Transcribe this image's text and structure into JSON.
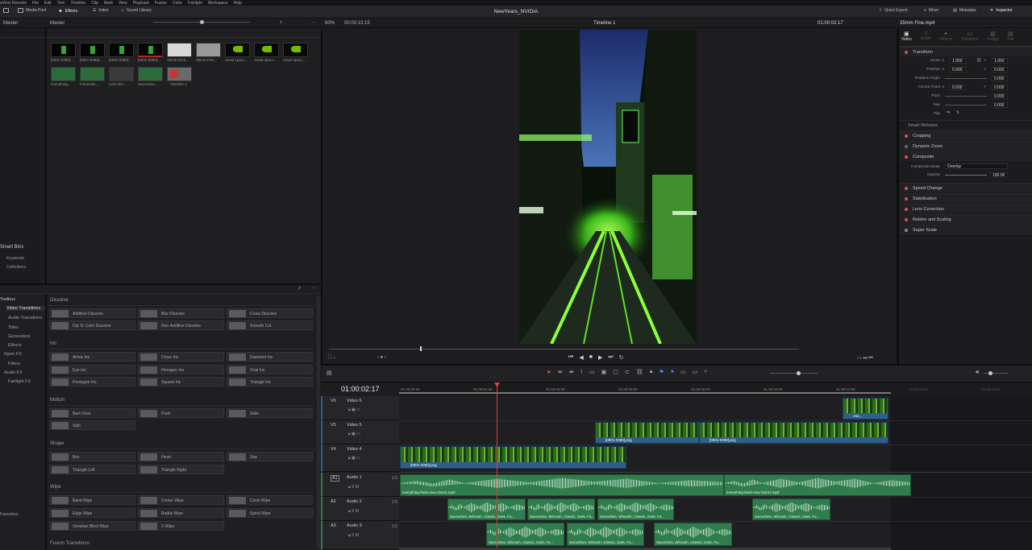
{
  "menu": {
    "items": [
      "aVinci Resolve",
      "File",
      "Edit",
      "Trim",
      "Timeline",
      "Clip",
      "Mark",
      "View",
      "Playback",
      "Fusion",
      "Color",
      "Fairlight",
      "Workspace",
      "Help"
    ]
  },
  "toolbar": {
    "media_pool": "Media Pool",
    "effects": "Effects",
    "index": "Index",
    "sound_library": "Sound Library",
    "project_title": "NewYears_NVIDIA",
    "quick_export": "Quick Export",
    "mixer": "Mixer",
    "metadata": "Metadata",
    "inspector": "Inspector"
  },
  "viewer": {
    "zoom": "60%",
    "source_timecode": "00:00:13:15",
    "timeline_name": "Timeline 1",
    "timecode": "01:00:02:17",
    "clip_name": "35mm Fine.mp4"
  },
  "media_pool": {
    "bin_left": "Master",
    "bin_right": "Master",
    "clips": [
      {
        "label": "[0001-0390]..."
      },
      {
        "label": "[0001-0390]..."
      },
      {
        "label": "[0001-0390]..."
      },
      {
        "label": "[0001-0390]..."
      },
      {
        "label": "16mm Scra..."
      },
      {
        "label": "35mm Fine..."
      },
      {
        "label": "Asset 1pmo..."
      },
      {
        "label": "Asset 2pmo..."
      },
      {
        "label": "Asset 3pmo..."
      },
      {
        "label": "everything..."
      },
      {
        "label": "Fireworks,..."
      },
      {
        "label": "Lens Dirt..."
      },
      {
        "label": "Swooshes,..."
      },
      {
        "label": "Timeline 1"
      }
    ],
    "smart_bins": "Smart Bins",
    "smart_bin_items": [
      "Keywords",
      "Collections"
    ]
  },
  "effects": {
    "toolbox": "Toolbox",
    "tree": [
      "Video Transitions",
      "Audio Transitions",
      "Titles",
      "Generators",
      "Effects",
      "Open FX",
      "Filters",
      "Audio FX",
      "Fairlight FX"
    ],
    "favorites": "Favorites",
    "categories": [
      {
        "name": "Dissolve",
        "items": [
          "Additive Dissolve",
          "Blur Dissolve",
          "Cross Dissolve",
          "Dip To Color Dissolve",
          "Non-Additive Dissolve",
          "Smooth Cut"
        ]
      },
      {
        "name": "Iris",
        "items": [
          "Arrow Iris",
          "Cross Iris",
          "Diamond Iris",
          "Eye Iris",
          "Hexagon Iris",
          "Oval Iris",
          "Pentagon Iris",
          "Square Iris",
          "Triangle Iris"
        ]
      },
      {
        "name": "Motion",
        "items": [
          "Barn Door",
          "Push",
          "Slide",
          "Split"
        ]
      },
      {
        "name": "Shape",
        "items": [
          "Box",
          "Heart",
          "Star",
          "Triangle Left",
          "Triangle Right"
        ]
      },
      {
        "name": "Wipe",
        "items": [
          "Band Wipe",
          "Center Wipe",
          "Clock Wipe",
          "Edge Wipe",
          "Radial Wipe",
          "Spiral Wipe",
          "Venetian Blind Wipe",
          "X Wipe"
        ]
      },
      {
        "name": "Fusion Transitions",
        "items": []
      }
    ]
  },
  "inspector": {
    "tabs": [
      "Video",
      "Audio",
      "Effects",
      "Transition",
      "Image",
      "File"
    ],
    "transform": "Transform",
    "zoom_label": "Zoom",
    "zoom_x": "1.000",
    "zoom_y": "1.000",
    "position_label": "Position",
    "position_x": "0.000",
    "position_y": "0.000",
    "rotation_label": "Rotation Angle",
    "rotation": "0.000",
    "anchor_label": "Anchor Point",
    "anchor_x": "0.000",
    "anchor_y": "0.000",
    "pitch_label": "Pitch",
    "pitch": "0.000",
    "yaw_label": "Yaw",
    "yaw": "0.000",
    "flip_label": "Flip",
    "smart_reframe": "Smart Reframe",
    "cropping": "Cropping",
    "dynamic_zoom": "Dynamic Zoom",
    "composite": "Composite",
    "composite_mode_label": "Composite Mode",
    "composite_mode": "Overlay",
    "opacity_label": "Opacity",
    "opacity": "100.00",
    "sections": [
      "Speed Change",
      "Stabilization",
      "Lens Correction",
      "Retime and Scaling",
      "Super Scale"
    ],
    "axis_x": "X",
    "axis_y": "Y"
  },
  "timeline": {
    "timecode": "01:00:02:17",
    "ruler": [
      "01:00:00:00",
      "01:00:02:00",
      "01:00:04:00",
      "01:00:06:00",
      "01:00:08:00",
      "01:00:10:00",
      "01:00:12:00",
      "01:00:14:00",
      "01:00:16:00"
    ],
    "tracks": [
      {
        "id": "V6",
        "name": "Video 6"
      },
      {
        "id": "V5",
        "name": "Video 5"
      },
      {
        "id": "V4",
        "name": "Video 4"
      },
      {
        "id": "A1",
        "name": "Audio 1",
        "level": "2.0"
      },
      {
        "id": "A2",
        "name": "Audio 2",
        "level": "2.0"
      },
      {
        "id": "A3",
        "name": "Audio 3",
        "level": "2.0"
      }
    ],
    "clips": {
      "v6": "Ass...",
      "v5a": "[0001-0390].png",
      "v5b": "[0001-0390].png",
      "v4": "[0001-0390].png",
      "a1a": "everything-feels-new-15241.mp3",
      "a1b": "everything-feels-new-15241.mp3",
      "swoosh": "Swooshes, Whoosh, Classic, Dark, Fa..."
    }
  },
  "colors": {
    "accent_red": "#e05050",
    "playhead": "#e03c3c",
    "video_clip": "#2f5e8c",
    "audio_clip": "#2f7d4c"
  }
}
